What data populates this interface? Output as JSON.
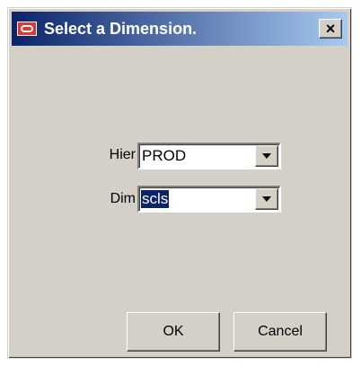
{
  "window": {
    "title": "Select a Dimension.",
    "close_label": "×"
  },
  "form": {
    "hier": {
      "label": "Hier",
      "value": "PROD"
    },
    "dim": {
      "label": "Dim",
      "value": "scls"
    }
  },
  "buttons": {
    "ok": "OK",
    "cancel": "Cancel"
  },
  "colors": {
    "title_bar_start": "#0a246a",
    "title_bar_end": "#a6caf0",
    "dialog_face": "#d4d0c8",
    "selection": "#0a246a",
    "app_icon": "#e5372b"
  }
}
